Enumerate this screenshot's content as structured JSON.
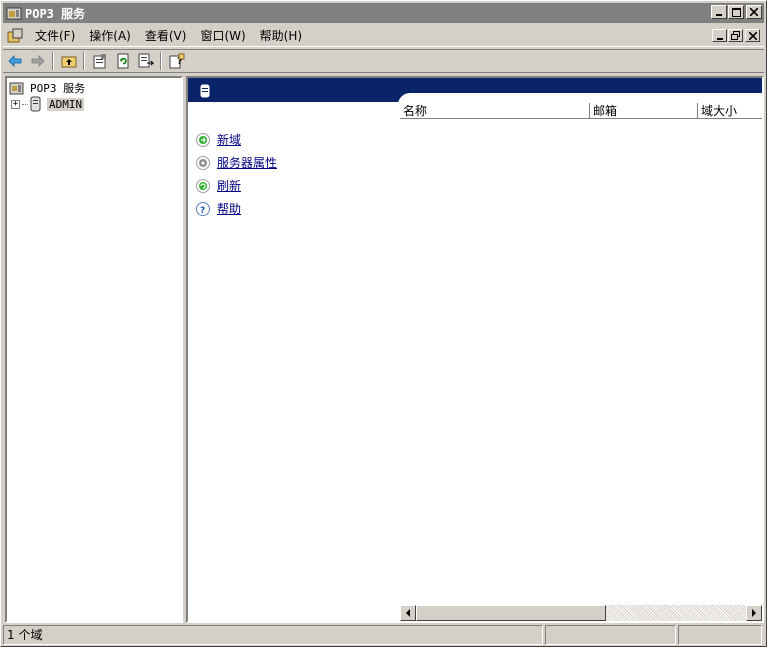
{
  "window": {
    "title": "POP3 服务"
  },
  "menu": {
    "items": [
      "文件(F)",
      "操作(A)",
      "查看(V)",
      "窗口(W)",
      "帮助(H)"
    ]
  },
  "tree": {
    "root_label": "POP3 服务",
    "child_label": "ADMIN",
    "expander": "+"
  },
  "list": {
    "columns": [
      "名称",
      "邮箱",
      "域大小"
    ]
  },
  "tasks": [
    {
      "label": "新域",
      "icon": "new-domain-icon"
    },
    {
      "label": "服务器属性",
      "icon": "server-properties-icon"
    },
    {
      "label": "刷新",
      "icon": "refresh-icon"
    },
    {
      "label": "帮助",
      "icon": "help-icon"
    }
  ],
  "status": {
    "text": "1 个域"
  },
  "colors": {
    "title_inactive": "#808080",
    "taskpad_header": "#0a246a",
    "link": "#000080",
    "face": "#d4d0c8"
  }
}
